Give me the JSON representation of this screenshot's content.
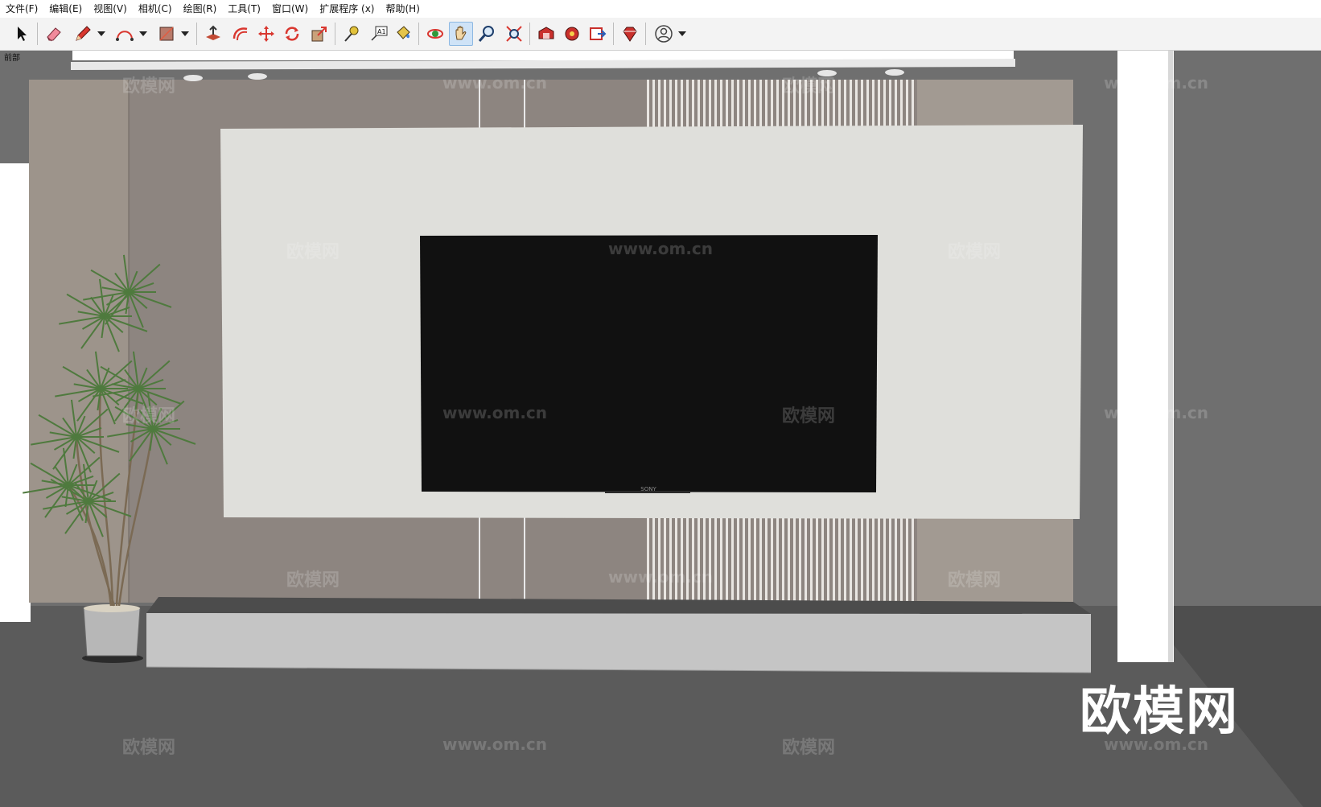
{
  "menubar": {
    "items": [
      "文件(F)",
      "编辑(E)",
      "视图(V)",
      "相机(C)",
      "绘图(R)",
      "工具(T)",
      "窗口(W)",
      "扩展程序 (x)",
      "帮助(H)"
    ]
  },
  "toolbar": {
    "tools": [
      {
        "name": "select-tool",
        "icon": "arrow-cursor-icon"
      },
      {
        "name": "eraser-tool",
        "icon": "eraser-icon"
      },
      {
        "name": "line-tool",
        "icon": "pencil-icon"
      },
      {
        "name": "arc-tool",
        "icon": "arc-icon"
      },
      {
        "name": "shape-tool",
        "icon": "rectangle-icon"
      },
      {
        "name": "push-pull-tool",
        "icon": "push-pull-icon"
      },
      {
        "name": "offset-tool",
        "icon": "offset-icon"
      },
      {
        "name": "move-tool",
        "icon": "move-icon"
      },
      {
        "name": "rotate-tool",
        "icon": "rotate-icon"
      },
      {
        "name": "scale-tool",
        "icon": "scale-icon"
      },
      {
        "name": "tape-measure-tool",
        "icon": "tape-measure-icon"
      },
      {
        "name": "text-tool",
        "icon": "text-label-icon"
      },
      {
        "name": "paint-bucket-tool",
        "icon": "paint-bucket-icon"
      },
      {
        "name": "orbit-tool",
        "icon": "orbit-icon"
      },
      {
        "name": "pan-tool",
        "icon": "hand-icon"
      },
      {
        "name": "zoom-tool",
        "icon": "magnifier-icon"
      },
      {
        "name": "zoom-extents-tool",
        "icon": "zoom-extents-icon"
      },
      {
        "name": "warehouse-tool",
        "icon": "warehouse-icon"
      },
      {
        "name": "extension-warehouse-tool",
        "icon": "extension-icon"
      },
      {
        "name": "send-to-layout-tool",
        "icon": "layout-icon"
      },
      {
        "name": "ruby-console-tool",
        "icon": "ruby-gem-icon"
      },
      {
        "name": "account-tool",
        "icon": "user-account-icon"
      }
    ],
    "active_tool": "pan-tool",
    "text_tool_glyph": "A1"
  },
  "scene": {
    "label": "前部",
    "tv_brand": "SONY",
    "watermark_logo": "欧模网",
    "watermark_url": "www.om.cn",
    "corner_logo": "欧模网"
  },
  "colors": {
    "background": "#6f6f6f",
    "floor": "#5a5a5a",
    "wall_panel": "#8d8580",
    "wood_panel": "#9b938b",
    "back_panel": "#dfdfdb",
    "tv_screen": "#111111",
    "cabinet": "#c8c8c8",
    "column": "#ffffff"
  }
}
